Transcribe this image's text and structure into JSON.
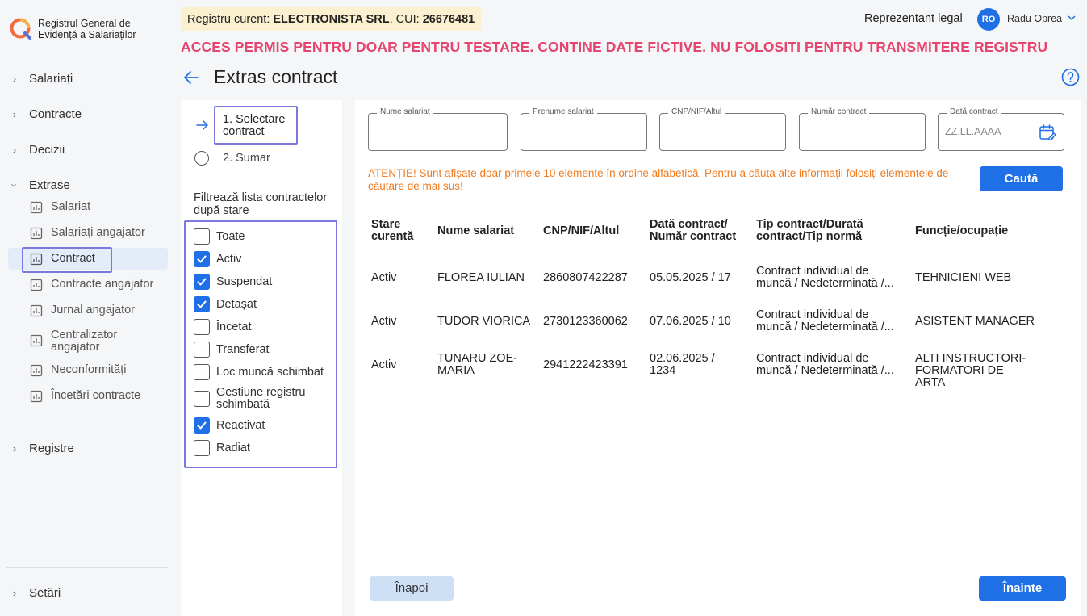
{
  "app": {
    "name": "Registrul General de Evidență a Salariaților"
  },
  "sidebar": {
    "sections": [
      {
        "label": "Salariați"
      },
      {
        "label": "Contracte"
      },
      {
        "label": "Decizii"
      },
      {
        "label": "Extrase"
      },
      {
        "label": "Registre"
      },
      {
        "label": "Setări"
      }
    ],
    "extrase_items": [
      {
        "label": "Salariat"
      },
      {
        "label": "Salariați angajator"
      },
      {
        "label": "Contract"
      },
      {
        "label": "Contracte angajator"
      },
      {
        "label": "Jurnal angajator"
      },
      {
        "label": "Centralizator angajator"
      },
      {
        "label": "Neconformități"
      },
      {
        "label": "Încetări contracte"
      }
    ],
    "active_item": "Contract"
  },
  "header": {
    "registry_prefix": "Registru curent: ",
    "registry_company": "ELECTRONISTA SRL",
    "registry_cui_label": ", CUI: ",
    "registry_cui": "26676481",
    "role": "Reprezentant legal",
    "avatar_initials": "RO",
    "user_name": "Radu Oprea",
    "warning": "ACCES PERMIS PENTRU DOAR PENTRU TESTARE. CONTINE DATE FICTIVE. NU FOLOSITI PENTRU TRANSMITERE REGISTRU"
  },
  "page": {
    "title": "Extras contract"
  },
  "steps": [
    {
      "label": "1. Selectare contract"
    },
    {
      "label": "2. Sumar"
    }
  ],
  "filter": {
    "label": "Filtrează lista contractelor după stare",
    "options": [
      {
        "label": "Toate",
        "checked": false
      },
      {
        "label": "Activ",
        "checked": true
      },
      {
        "label": "Suspendat",
        "checked": true
      },
      {
        "label": "Detașat",
        "checked": true
      },
      {
        "label": "Încetat",
        "checked": false
      },
      {
        "label": "Transferat",
        "checked": false
      },
      {
        "label": "Loc muncă schimbat",
        "checked": false
      },
      {
        "label": "Gestiune registru schimbată",
        "checked": false
      },
      {
        "label": "Reactivat",
        "checked": true
      },
      {
        "label": "Radiat",
        "checked": false
      }
    ]
  },
  "search": {
    "fields": [
      {
        "label": "Nume salariat",
        "value": "",
        "placeholder": ""
      },
      {
        "label": "Prenume salariat",
        "value": "",
        "placeholder": ""
      },
      {
        "label": "CNP/NIF/Altul",
        "value": "",
        "placeholder": ""
      },
      {
        "label": "Număr contract",
        "value": "",
        "placeholder": ""
      },
      {
        "label": "Dată contract",
        "value": "",
        "placeholder": "ZZ.LL.AAAA"
      }
    ],
    "attention": "ATENȚIE! Sunt afișate doar primele 10 elemente în ordine alfabetică. Pentru a căuta alte informații folosiți elementele de căutare de mai sus!",
    "search_button": "Caută"
  },
  "table": {
    "headers": [
      "Stare curentă",
      "Nume salariat",
      "CNP/NIF/Altul",
      "Dată contract/ Număr contract",
      "Tip contract/Durată contract/Tip normă",
      "Funcție/ocupație"
    ],
    "rows": [
      [
        "Activ",
        "FLOREA IULIAN",
        "2860807422287",
        "05.05.2025 / 17",
        "Contract individual de muncă / Nedeterminată /...",
        "TEHNICIENI WEB"
      ],
      [
        "Activ",
        "TUDOR VIORICA",
        "2730123360062",
        "07.06.2025 / 10",
        "Contract individual de muncă / Nedeterminată /...",
        "ASISTENT MANAGER"
      ],
      [
        "Activ",
        "TUNARU ZOE-MARIA",
        "2941222423391",
        "02.06.2025 / 1234",
        "Contract individual de muncă / Nedeterminată /...",
        "ALTI INSTRUCTORI-FORMATORI DE ARTA"
      ]
    ]
  },
  "footer": {
    "back_button": "Înapoi",
    "next_button": "Înainte"
  },
  "colors": {
    "primary": "#1f6fe6",
    "warning": "#e5466f",
    "attention": "#f07a1d",
    "highlight": "#7b78e0",
    "registry_bg": "#fbf0cf"
  }
}
